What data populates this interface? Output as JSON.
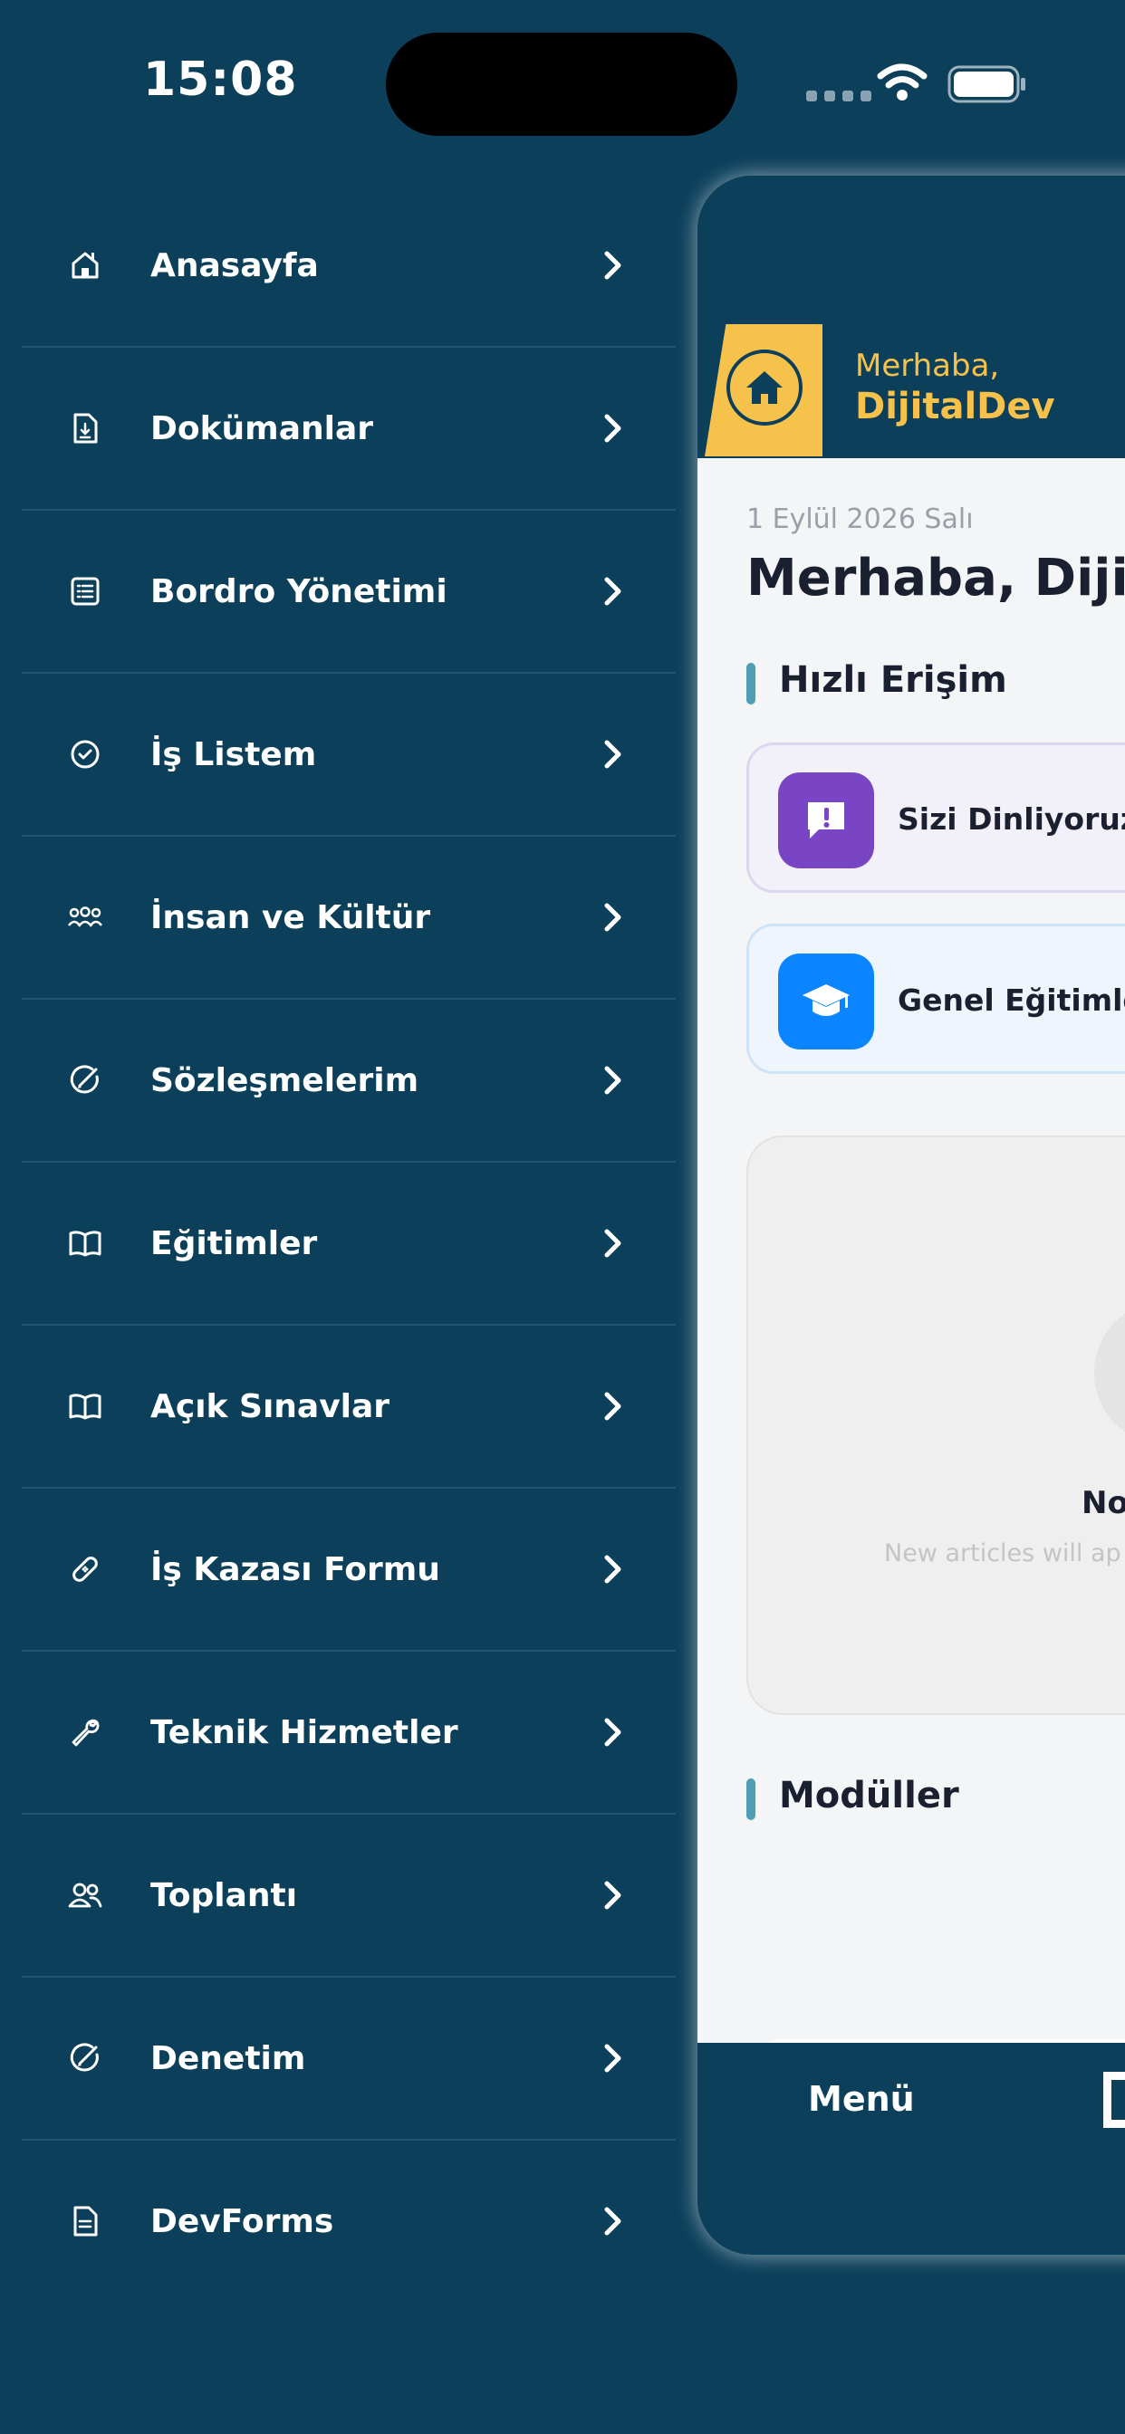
{
  "status_bar": {
    "time": "15:08"
  },
  "menu": {
    "items": [
      {
        "label": "Anasayfa",
        "icon": "home-icon"
      },
      {
        "label": "Dokümanlar",
        "icon": "document-icon"
      },
      {
        "label": "Bordro Yönetimi",
        "icon": "list-icon"
      },
      {
        "label": "İş Listem",
        "icon": "check-circle-icon"
      },
      {
        "label": "İnsan ve Kültür",
        "icon": "people-group-icon"
      },
      {
        "label": "Sözleşmelerim",
        "icon": "signature-icon"
      },
      {
        "label": "Eğitimler",
        "icon": "book-icon"
      },
      {
        "label": "Açık Sınavlar",
        "icon": "book-icon"
      },
      {
        "label": "İş Kazası Formu",
        "icon": "bandage-icon"
      },
      {
        "label": "Teknik Hizmetler",
        "icon": "wrench-icon"
      },
      {
        "label": "Toplantı",
        "icon": "people-icon"
      },
      {
        "label": "Denetim",
        "icon": "signature-icon"
      },
      {
        "label": "DevForms",
        "icon": "form-icon"
      }
    ]
  },
  "preview": {
    "header": {
      "greeting": "Merhaba,",
      "name": "DijitalDev"
    },
    "date": "1 Eylül 2026 Salı",
    "big_greeting": "Merhaba, Dijita",
    "quick_access_title": "Hızlı Erişim",
    "quick_access": [
      {
        "label": "Sizi Dinliyoruz",
        "icon": "feedback-icon",
        "color": "#7a45c4"
      },
      {
        "label": "Genel Eğitimler",
        "icon": "graduation-cap-icon",
        "color": "#0a84ff"
      }
    ],
    "news": {
      "title": "No",
      "subtitle": "New articles will ap"
    },
    "modules_title": "Modüller",
    "tabbar": {
      "menu_label": "Menü"
    }
  },
  "colors": {
    "background": "#0b3f5a",
    "accent": "#f6c24c"
  }
}
